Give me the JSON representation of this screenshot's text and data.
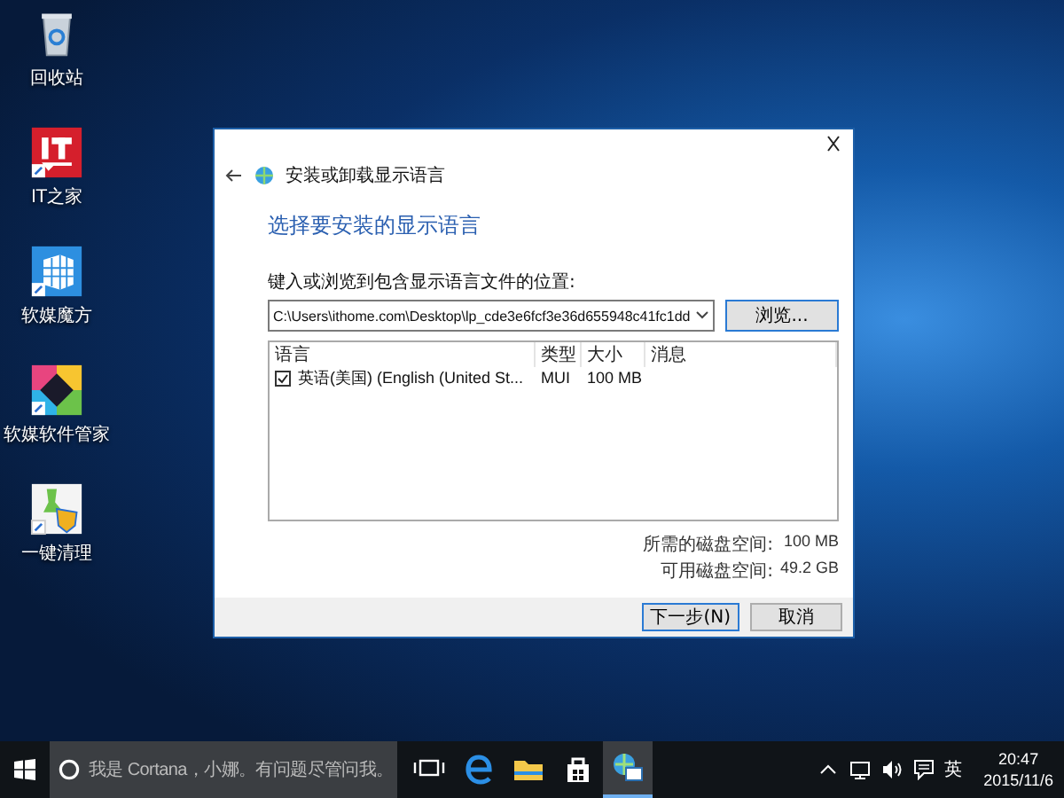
{
  "desktop_icons": [
    {
      "kind": "recycle-bin",
      "label": "回收站"
    },
    {
      "kind": "it-home",
      "label": "IT之家"
    },
    {
      "kind": "cube",
      "label": "软媒魔方"
    },
    {
      "kind": "app-manager",
      "label": "软媒软件管家"
    },
    {
      "kind": "cleaner",
      "label": "一键清理"
    }
  ],
  "dialog": {
    "nav_title": "安装或卸载显示语言",
    "heading": "选择要安装的显示语言",
    "path_label": "键入或浏览到包含显示语言文件的位置:",
    "path_value": "C:\\Users\\ithome.com\\Desktop\\lp_cde3e6fcf3e36d655948c41fc1dd",
    "browse_button": "浏览...",
    "columns": [
      "语言",
      "类型",
      "大小",
      "消息"
    ],
    "rows": [
      {
        "checked": true,
        "language": "英语(美国) (English (United St...",
        "type": "MUI",
        "size": "100 MB"
      }
    ],
    "disk_info": [
      {
        "label": "所需的磁盘空间:",
        "value": "100 MB"
      },
      {
        "label": "可用磁盘空间:",
        "value": "49.2 GB"
      }
    ],
    "buttons": [
      {
        "label": "下一步(N)",
        "default": true
      },
      {
        "label": "取消",
        "default": false
      }
    ]
  },
  "taskbar": {
    "search_placeholder": "我是 Cortana，小娜。有问题尽管问我。",
    "apps": [
      {
        "kind": "task-view",
        "selected": false
      },
      {
        "kind": "edge",
        "selected": false
      },
      {
        "kind": "explorer",
        "selected": false
      },
      {
        "kind": "store",
        "selected": false
      },
      {
        "kind": "language-settings",
        "selected": true
      }
    ],
    "input_language": "英",
    "time": "20:47",
    "date": "2015/11/6"
  }
}
